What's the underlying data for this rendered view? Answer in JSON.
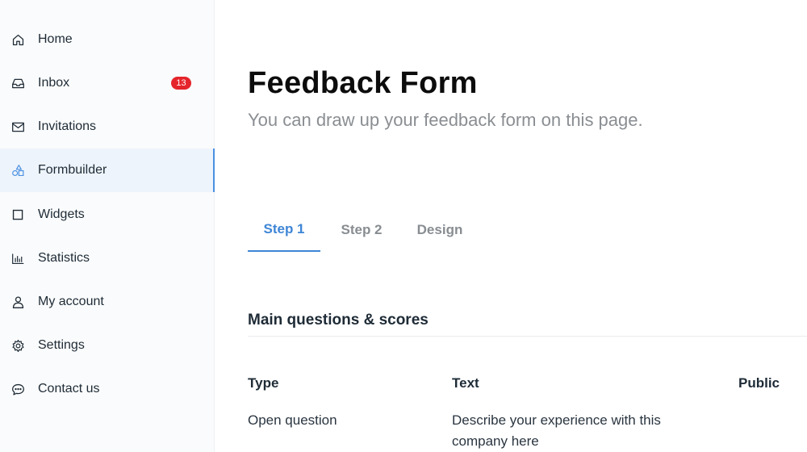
{
  "sidebar": {
    "items": [
      {
        "label": "Home",
        "icon": "home-icon"
      },
      {
        "label": "Inbox",
        "icon": "inbox-icon",
        "badge": "13"
      },
      {
        "label": "Invitations",
        "icon": "mail-icon"
      },
      {
        "label": "Formbuilder",
        "icon": "shapes-icon",
        "active": true
      },
      {
        "label": "Widgets",
        "icon": "square-icon"
      },
      {
        "label": "Statistics",
        "icon": "bar-chart-icon"
      },
      {
        "label": "My account",
        "icon": "user-icon"
      },
      {
        "label": "Settings",
        "icon": "gear-icon"
      },
      {
        "label": "Contact us",
        "icon": "chat-icon"
      }
    ]
  },
  "header": {
    "title": "Feedback Form",
    "subtitle": "You can draw up your feedback form on this page."
  },
  "tabs": [
    {
      "label": "Step 1",
      "active": true
    },
    {
      "label": "Step 2"
    },
    {
      "label": "Design"
    }
  ],
  "section": {
    "title": "Main questions & scores"
  },
  "table": {
    "columns": [
      "Type",
      "Text",
      "Public"
    ],
    "rows": [
      {
        "type": "Open question",
        "text": "Describe your experience with this company here"
      }
    ]
  },
  "colors": {
    "accent": "#3f86d6",
    "badge": "#e5242b"
  }
}
